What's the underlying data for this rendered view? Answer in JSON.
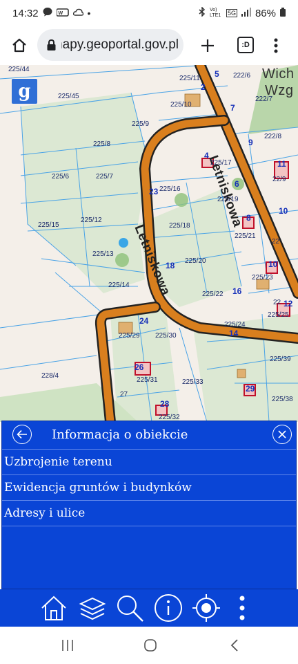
{
  "status_bar": {
    "time": "14:32",
    "battery": "86%",
    "network": "5G",
    "volte": "Vo) LTE1"
  },
  "browser": {
    "url": "mapy.geoportal.gov.pl",
    "tab_count": ":D"
  },
  "map": {
    "streets": [
      "Letniskowa",
      "Letniskowa",
      "Letniskowa"
    ],
    "place_label_1": "Wich",
    "place_label_2": "Wzg",
    "parcels": [
      "225/44",
      "225/45",
      "225/11",
      "222/6",
      "225/10",
      "222/7",
      "225/9",
      "225/8",
      "222/8",
      "225/6",
      "225/7",
      "225/17",
      "22/9",
      "225/16",
      "225/19",
      "225/15",
      "225/12",
      "225/18",
      "225/21",
      "22",
      "225/13",
      "225/20",
      "225/23",
      "225/14",
      "225/22",
      "225/25",
      "225/24",
      "225/29",
      "225/30",
      "225/39",
      "228/4",
      "225/31",
      "225/33",
      "225/38",
      "22",
      "27",
      "225/32"
    ],
    "house_numbers": [
      "5",
      "2",
      "7",
      "9",
      "4",
      "11",
      "6",
      "10",
      "23",
      "8",
      "18",
      "10",
      "16",
      "12",
      "14",
      "24",
      "26",
      "29",
      "28"
    ]
  },
  "info_panel": {
    "title": "Informacja o obiekcie",
    "items": [
      "Uzbrojenie terenu",
      "Ewidencja gruntów i budynków",
      "Adresy i ulice"
    ]
  },
  "toolbar": {
    "icons": [
      "home-icon",
      "layers-icon",
      "search-icon",
      "info-icon",
      "locate-icon",
      "more-icon"
    ]
  },
  "colors": {
    "panel": "#0a45d6",
    "road": "#d97f1e",
    "parcel_green": "#dce8d3",
    "parcel_line": "#4aa3e6"
  }
}
